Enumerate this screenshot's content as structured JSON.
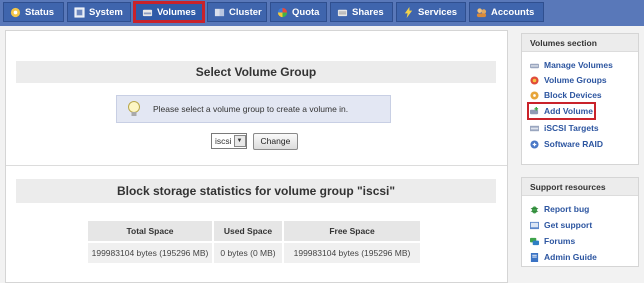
{
  "nav": {
    "tabs": [
      {
        "label": "Status"
      },
      {
        "label": "System"
      },
      {
        "label": "Volumes"
      },
      {
        "label": "Cluster"
      },
      {
        "label": "Quota"
      },
      {
        "label": "Shares"
      },
      {
        "label": "Services"
      },
      {
        "label": "Accounts"
      }
    ],
    "active_tab": "Volumes"
  },
  "main": {
    "select_group": {
      "title": "Select Volume Group",
      "info_text": "Please select a volume group to create a volume in.",
      "selected_value": "iscsi",
      "change_label": "Change"
    },
    "stats": {
      "title": "Block storage statistics for volume group \"iscsi\"",
      "headers": [
        "Total Space",
        "Used Space",
        "Free Space"
      ],
      "row": [
        "199983104 bytes (195296 MB)",
        "0 bytes (0 MB)",
        "199983104 bytes (195296 MB)"
      ]
    }
  },
  "sidebar": {
    "volumes_section": {
      "title": "Volumes section",
      "items": [
        {
          "label": "Manage Volumes",
          "icon": "disk-icon"
        },
        {
          "label": "Volume Groups",
          "icon": "group-icon"
        },
        {
          "label": "Block Devices",
          "icon": "block-device-icon"
        },
        {
          "label": "Add Volume",
          "icon": "add-disk-icon"
        },
        {
          "label": "iSCSI Targets",
          "icon": "target-icon"
        },
        {
          "label": "Software RAID",
          "icon": "raid-icon"
        }
      ],
      "highlighted": "Add Volume"
    },
    "support_section": {
      "title": "Support resources",
      "items": [
        {
          "label": "Report bug",
          "icon": "bug-icon"
        },
        {
          "label": "Get support",
          "icon": "support-icon"
        },
        {
          "label": "Forums",
          "icon": "forums-icon"
        },
        {
          "label": "Admin Guide",
          "icon": "guide-icon"
        }
      ]
    }
  },
  "colors": {
    "nav_bar": "#5978b9",
    "tab": "#3f65ad",
    "link": "#2c55a0",
    "highlight": "#c9222a"
  }
}
